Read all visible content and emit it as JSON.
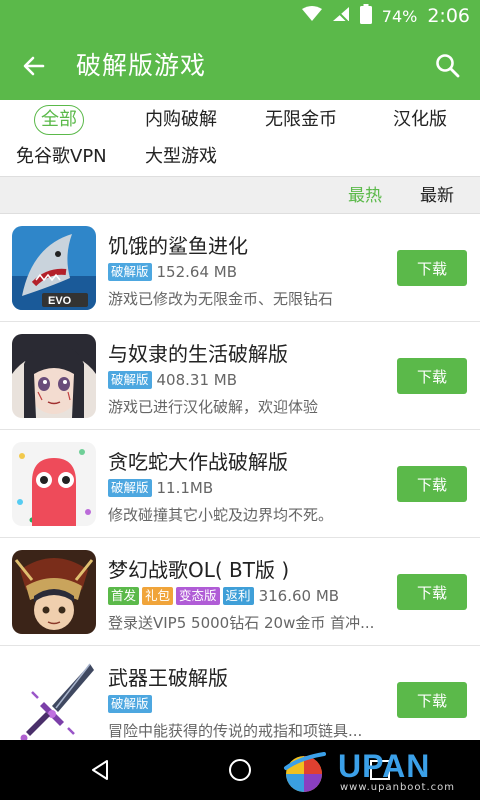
{
  "status": {
    "battery_pct": "74%",
    "time": "2:06"
  },
  "appbar": {
    "title": "破解版游戏"
  },
  "categories": [
    "全部",
    "内购破解",
    "无限金币",
    "汉化版",
    "免谷歌VPN",
    "大型游戏"
  ],
  "sort": {
    "hot": "最热",
    "new": "最新"
  },
  "games": [
    {
      "name": "饥饿的鲨鱼进化",
      "badges": [
        "破解版"
      ],
      "size": "152.64 MB",
      "desc": "游戏已修改为无限金币、无限钻石",
      "button": "下载"
    },
    {
      "name": "与奴隶的生活破解版",
      "badges": [
        "破解版"
      ],
      "size": "408.31 MB",
      "desc": "游戏已进行汉化破解，欢迎体验",
      "button": "下载"
    },
    {
      "name": "贪吃蛇大作战破解版",
      "badges": [
        "破解版"
      ],
      "size": "11.1MB",
      "desc": "修改碰撞其它小蛇及边界均不死。",
      "button": "下载"
    },
    {
      "name": "梦幻战歌OL( BT版 )",
      "badges": [
        "首发",
        "礼包",
        "变态版",
        "返利"
      ],
      "size": "316.60 MB",
      "desc": "登录送VIP5 5000钻石 20w金币 首冲...",
      "button": "下载"
    },
    {
      "name": "武器王破解版",
      "badges": [
        "破解版"
      ],
      "size": "",
      "desc": "冒险中能获得的传说的戒指和项链具...",
      "button": "下载"
    }
  ],
  "badge_colors": {
    "破解版": "#4da7e0",
    "首发": "#5bb94a",
    "礼包": "#f0a43a",
    "变态版": "#b05cd6",
    "返利": "#3f9fd8"
  },
  "colors": {
    "accent": "#5bb94a"
  },
  "watermark": {
    "brand": "UPAN",
    "url": "www.upanboot.com"
  }
}
